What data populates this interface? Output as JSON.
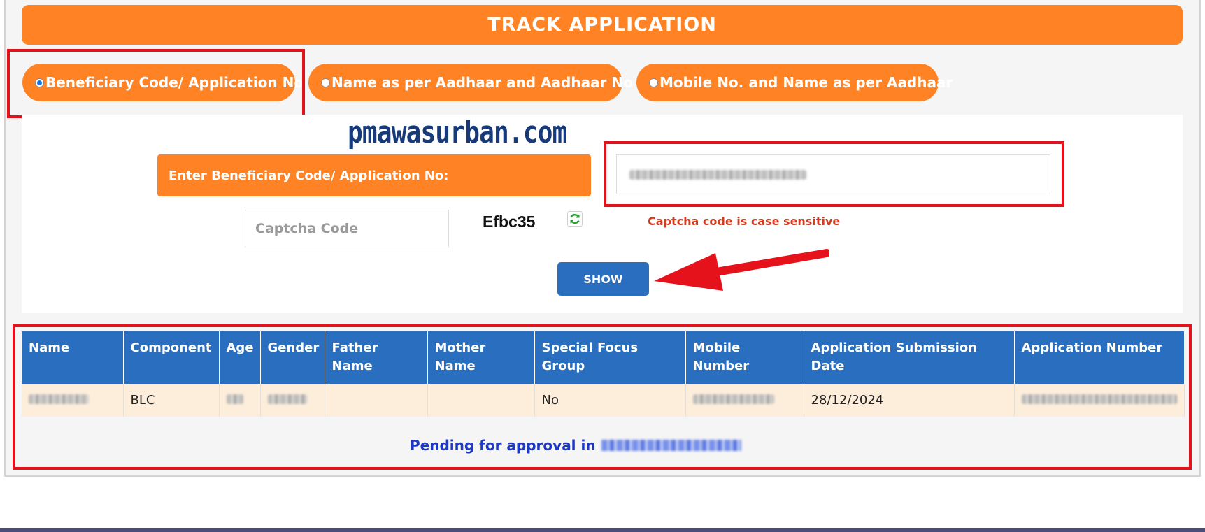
{
  "header": {
    "title": "TRACK APPLICATION"
  },
  "search_options": [
    {
      "label": "Beneficiary Code/ Application No",
      "selected": true
    },
    {
      "label": "Name as per Aadhaar and Aadhaar No",
      "selected": false
    },
    {
      "label": "Mobile No. and Name as per Aadhaar",
      "selected": false
    }
  ],
  "watermark": "pmawasurban.com",
  "form": {
    "field_label": "Enter Beneficiary Code/ Application No:",
    "captcha_placeholder": "Captcha Code",
    "captcha_value": "Efbc35",
    "captcha_note": "Captcha code is case sensitive",
    "show_button": "SHOW"
  },
  "table": {
    "columns": [
      "Name",
      "Component",
      "Age",
      "Gender",
      "Father Name",
      "Mother Name",
      "Special Focus Group",
      "Mobile Number",
      "Application Submission Date",
      "Application Number"
    ],
    "row": [
      "",
      "BLC",
      "",
      "",
      "",
      "",
      "No",
      "",
      "28/12/2024",
      ""
    ]
  },
  "status": {
    "text": "Pending for approval in"
  },
  "colors": {
    "orange": "#ff8324",
    "blue": "#2a6fbf",
    "highlight_red": "#e5121c"
  },
  "icons": [
    "radio-icon",
    "refresh-icon",
    "arrow-icon"
  ]
}
